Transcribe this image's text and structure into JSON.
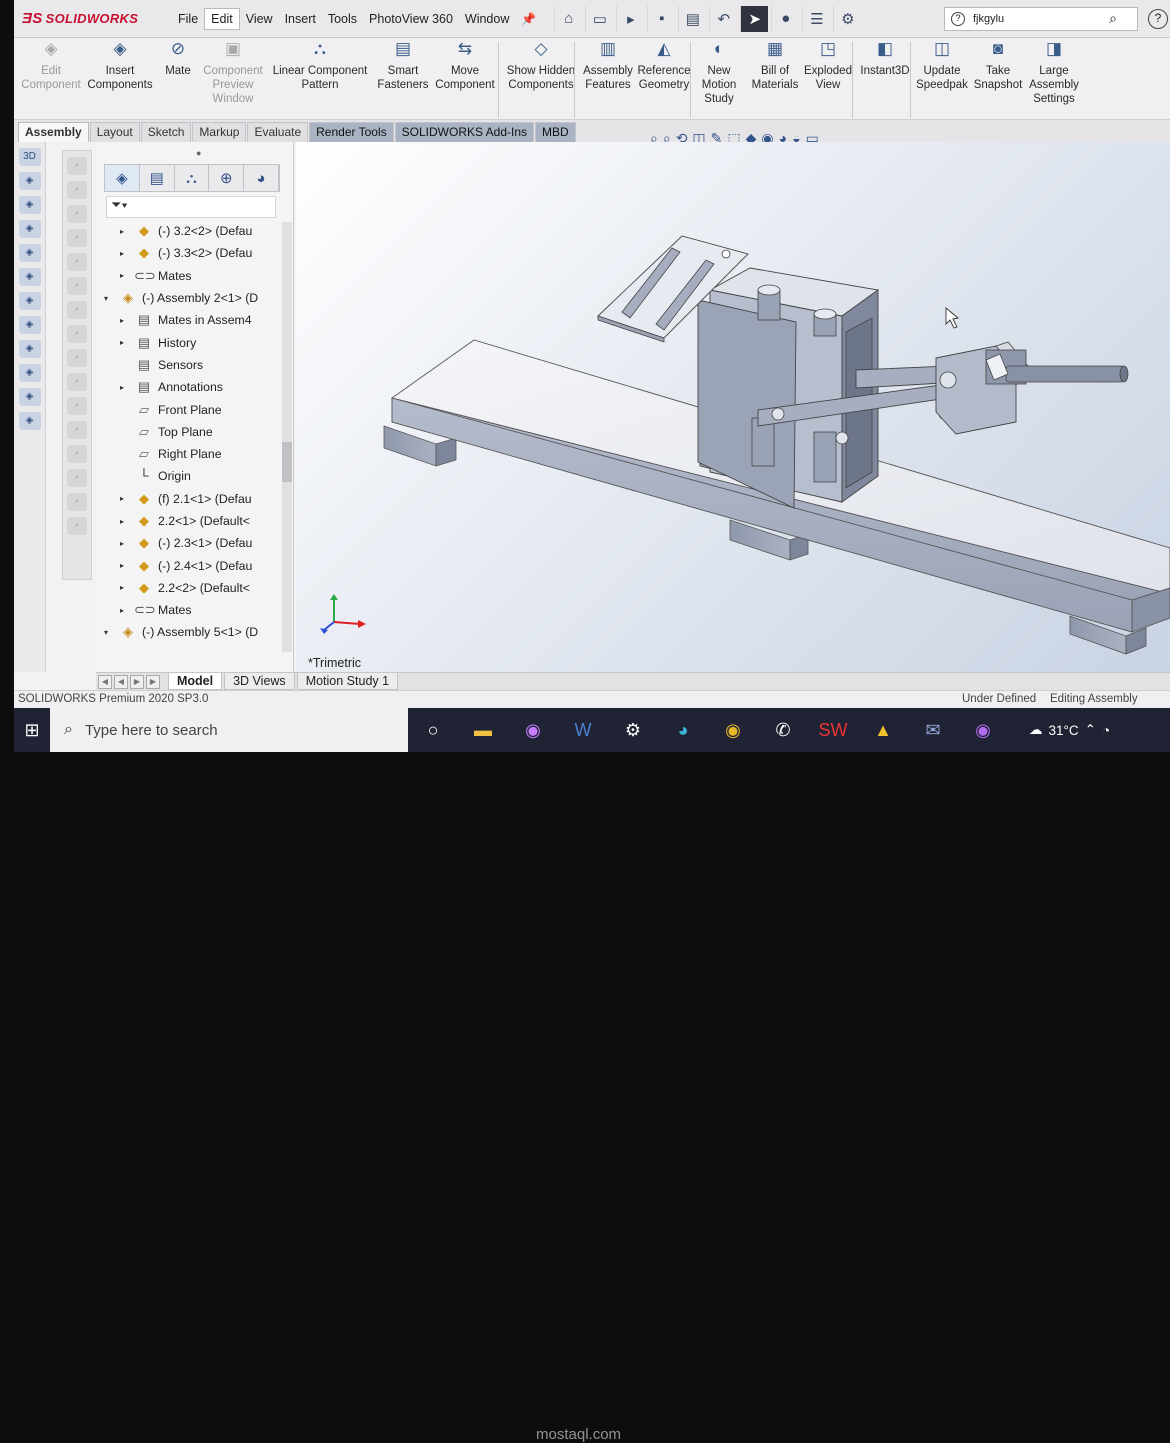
{
  "app": {
    "name": "SOLIDWORKS"
  },
  "menu": [
    "File",
    "Edit",
    "View",
    "Insert",
    "Tools",
    "PhotoView 360",
    "Window"
  ],
  "search": {
    "value": "fjkgylu"
  },
  "ribbon": {
    "buttons": [
      {
        "label": "Edit Component",
        "disabled": true,
        "icon": "edit-component-icon"
      },
      {
        "label": "Insert Components",
        "disabled": false,
        "icon": "insert-components-icon"
      },
      {
        "label": "Mate",
        "disabled": false,
        "icon": "mate-icon"
      },
      {
        "label": "Component Preview Window",
        "disabled": true,
        "icon": "component-preview-icon"
      },
      {
        "label": "Linear Component Pattern",
        "disabled": false,
        "icon": "linear-pattern-icon"
      },
      {
        "label": "Smart Fasteners",
        "disabled": false,
        "icon": "smart-fasteners-icon"
      },
      {
        "label": "Move Component",
        "disabled": false,
        "icon": "move-component-icon"
      },
      {
        "label": "Show Hidden Components",
        "disabled": false,
        "icon": "show-hidden-icon"
      },
      {
        "label": "Assembly Features",
        "disabled": false,
        "icon": "assembly-features-icon"
      },
      {
        "label": "Reference Geometry",
        "disabled": false,
        "icon": "reference-geometry-icon"
      },
      {
        "label": "New Motion Study",
        "disabled": false,
        "icon": "motion-study-icon"
      },
      {
        "label": "Bill of Materials",
        "disabled": false,
        "icon": "bill-of-materials-icon"
      },
      {
        "label": "Exploded View",
        "disabled": false,
        "icon": "exploded-view-icon"
      },
      {
        "label": "Instant3D",
        "disabled": false,
        "icon": "instant3d-icon"
      },
      {
        "label": "Update Speedpak",
        "disabled": false,
        "icon": "speedpak-icon"
      },
      {
        "label": "Take Snapshot",
        "disabled": false,
        "icon": "camera-icon"
      },
      {
        "label": "Large Assembly Settings",
        "disabled": false,
        "icon": "large-assembly-icon"
      }
    ]
  },
  "tabs": [
    "Assembly",
    "Layout",
    "Sketch",
    "Markup",
    "Evaluate",
    "Render Tools",
    "SOLIDWORKS Add-Ins",
    "MBD"
  ],
  "tree": [
    {
      "label": "(-) 3.2<2> (Defau",
      "type": "part",
      "arrow": "▸",
      "indent": 1
    },
    {
      "label": "(-) 3.3<2> (Defau",
      "type": "part",
      "arrow": "▸",
      "indent": 1
    },
    {
      "label": "Mates",
      "type": "mate",
      "arrow": "▸",
      "indent": 1
    },
    {
      "label": "(-) Assembly 2<1> (D",
      "type": "asm",
      "arrow": "▾",
      "indent": 0
    },
    {
      "label": "Mates in Assem4",
      "type": "doc",
      "arrow": "▸",
      "indent": 1
    },
    {
      "label": "History",
      "type": "doc",
      "arrow": "▸",
      "indent": 1
    },
    {
      "label": "Sensors",
      "type": "doc",
      "arrow": "",
      "indent": 1
    },
    {
      "label": "Annotations",
      "type": "doc",
      "arrow": "▸",
      "indent": 1
    },
    {
      "label": "Front Plane",
      "type": "plane",
      "arrow": "",
      "indent": 1
    },
    {
      "label": "Top Plane",
      "type": "plane",
      "arrow": "",
      "indent": 1
    },
    {
      "label": "Right Plane",
      "type": "plane",
      "arrow": "",
      "indent": 1
    },
    {
      "label": "Origin",
      "type": "origin",
      "arrow": "",
      "indent": 1
    },
    {
      "label": "(f) 2.1<1> (Defau",
      "type": "part",
      "arrow": "▸",
      "indent": 1
    },
    {
      "label": "2.2<1> (Default<",
      "type": "part",
      "arrow": "▸",
      "indent": 1
    },
    {
      "label": "(-) 2.3<1> (Defau",
      "type": "part",
      "arrow": "▸",
      "indent": 1
    },
    {
      "label": "(-) 2.4<1> (Defau",
      "type": "part",
      "arrow": "▸",
      "indent": 1
    },
    {
      "label": "2.2<2> (Default<",
      "type": "part",
      "arrow": "▸",
      "indent": 1
    },
    {
      "label": "Mates",
      "type": "mate",
      "arrow": "▸",
      "indent": 1
    },
    {
      "label": "(-) Assembly 5<1> (D",
      "type": "asm",
      "arrow": "▾",
      "indent": 0
    }
  ],
  "viewport": {
    "view_name": "*Trimetric"
  },
  "bottom_tabs": [
    "Model",
    "3D Views",
    "Motion Study 1"
  ],
  "status": {
    "app": "SOLIDWORKS Premium 2020 SP3.0",
    "state": "Under Defined",
    "mode": "Editing Assembly"
  },
  "taskbar": {
    "search_placeholder": "Type here to search",
    "temperature": "31°C"
  },
  "watermark": "mostaql.com"
}
